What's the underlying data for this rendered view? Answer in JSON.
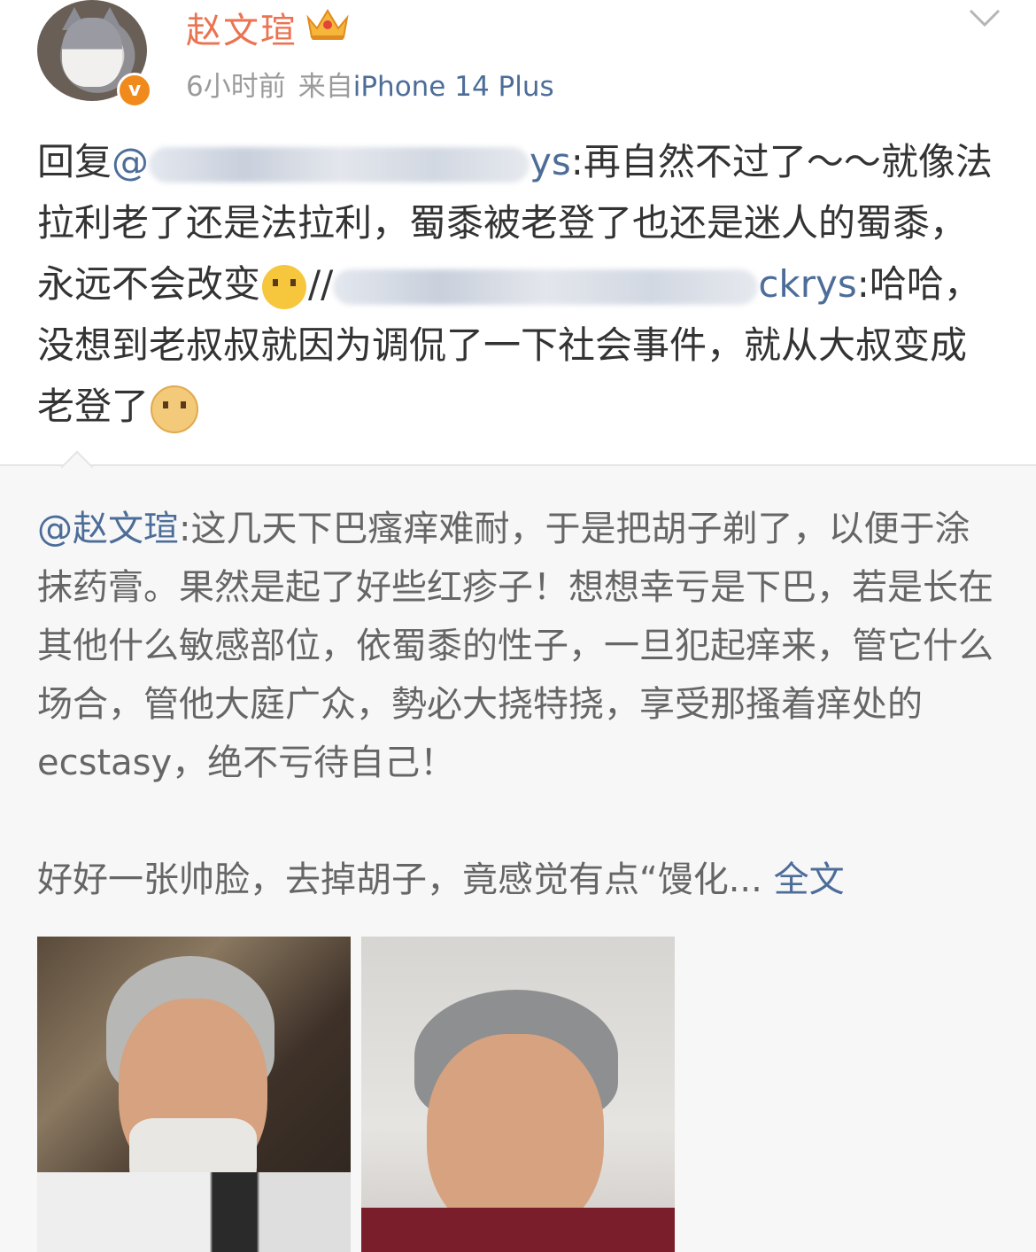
{
  "post": {
    "username": "赵文瑄",
    "time": "6小时前",
    "source_prefix": "来自",
    "device": "iPhone 14 Plus",
    "reply": {
      "prefix": "回复",
      "mention_at": "@",
      "mention_tail": "ys",
      "text1": ":再自然不过了～～就像法拉利老了还是法拉利，蜀黍被老登了也还是迷人的蜀黍，永远不会改变",
      "repost_sep": "//",
      "repost_mention_tail": "ckrys",
      "text2": ":哈哈，没想到老叔叔就因为调侃了一下社会事件，就从大叔变成老登了"
    }
  },
  "quoted": {
    "mention": "@赵文瑄",
    "paragraph1": ":这几天下巴瘙痒难耐，于是把胡子剃了，以便于涂抹药膏。果然是起了好些红疹子！想想幸亏是下巴，若是长在其他什么敏感部位，依蜀黍的性子，一旦犯起痒来，管它什么场合，管他大庭广众，勢必大挠特挠，享受那搔着痒处的ecstasy，绝不亏待自己！",
    "paragraph2": "好好一张帅脸，去掉胡子，竟感觉有点“馒化...",
    "more": "全文"
  },
  "colors": {
    "username": "#eb7350",
    "link": "#4d6d99",
    "verified_badge": "#f08a1c"
  },
  "icons": [
    "crown-icon",
    "verified-icon",
    "chevron-down-icon",
    "surprised-emoji",
    "doge-emoji"
  ]
}
